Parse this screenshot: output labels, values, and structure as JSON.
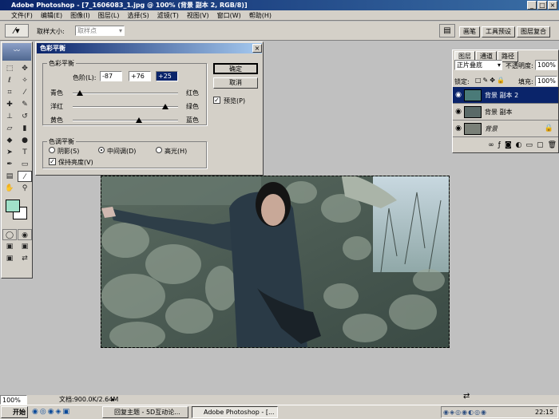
{
  "window": {
    "title": "Adobe Photoshop - [7_1606083_1.jpg @ 100% (背景 副本 2, RGB/8)]"
  },
  "menu": [
    "文件(F)",
    "编辑(E)",
    "图像(I)",
    "图层(L)",
    "选择(S)",
    "滤镜(T)",
    "视图(V)",
    "窗口(W)",
    "帮助(H)"
  ],
  "options": {
    "sample_size_label": "取样大小:",
    "sample_size_value": "取样点"
  },
  "palette_tabs": [
    "画笔",
    "工具预设",
    "图层复合"
  ],
  "dialog": {
    "title": "色彩平衡",
    "balance_group": "色彩平衡",
    "levels_label": "色阶(L):",
    "level1": "-87",
    "level2": "+76",
    "level3": "+25",
    "sliders": [
      {
        "left": "青色",
        "right": "红色",
        "value": -87
      },
      {
        "left": "洋红",
        "right": "绿色",
        "value": 76
      },
      {
        "left": "黄色",
        "right": "蓝色",
        "value": 25
      }
    ],
    "ok": "确定",
    "cancel": "取消",
    "preview": "预览(P)",
    "tone_group": "色调平衡",
    "shadows": "阴影(S)",
    "midtones": "中间调(D)",
    "highlights": "高光(H)",
    "preserve": "保持亮度(V)"
  },
  "layers": {
    "tabs": [
      "图层",
      "通道",
      "路径"
    ],
    "blend_mode": "正片叠底",
    "opacity_label": "不透明度:",
    "opacity": "100%",
    "lock_label": "锁定:",
    "fill_label": "填充:",
    "fill": "100%",
    "items": [
      "背景 副本 2",
      "背景 副本",
      "背景"
    ]
  },
  "status": {
    "zoom": "100%",
    "doc": "文档:900.0K/2.64M"
  },
  "taskbar": {
    "start": "开始",
    "tasks": [
      "回复主题 - 5D互动论...",
      "Adobe Photoshop - [..."
    ],
    "clock": "22:15"
  },
  "colors": {
    "title_bar": "#0a246a",
    "selection": "#0a246a",
    "foreground_swatch": "#a0e0c8"
  }
}
